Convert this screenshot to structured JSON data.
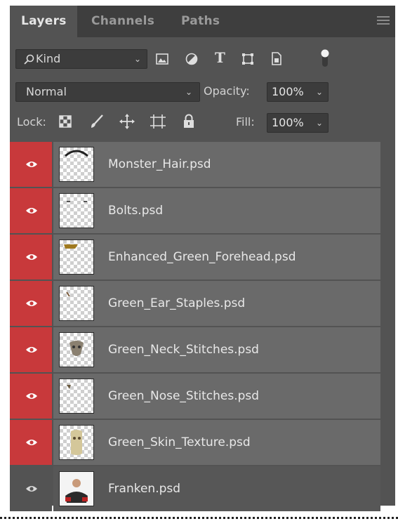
{
  "tabs": [
    {
      "label": "Layers",
      "active": true
    },
    {
      "label": "Channels",
      "active": false
    },
    {
      "label": "Paths",
      "active": false
    }
  ],
  "filter": {
    "label": "Kind",
    "icons": [
      "image-filter-icon",
      "adjustment-filter-icon",
      "type-filter-icon",
      "shape-filter-icon",
      "smart-object-filter-icon",
      "filter-toggle-icon"
    ]
  },
  "blend": {
    "mode": "Normal",
    "opacity_label": "Opacity:",
    "opacity_value": "100%"
  },
  "lock": {
    "label": "Lock:",
    "fill_label": "Fill:",
    "fill_value": "100%",
    "icons": [
      "lock-transparent-icon",
      "lock-paint-icon",
      "lock-position-icon",
      "lock-artboard-icon",
      "lock-all-icon"
    ]
  },
  "layers": [
    {
      "name": "Monster_Hair.psd",
      "selected": true
    },
    {
      "name": "Bolts.psd",
      "selected": true
    },
    {
      "name": "Enhanced_Green_Forehead.psd",
      "selected": true
    },
    {
      "name": "Green_Ear_Staples.psd",
      "selected": true
    },
    {
      "name": "Green_Neck_Stitches.psd",
      "selected": true
    },
    {
      "name": "Green_Nose_Stitches.psd",
      "selected": true
    },
    {
      "name": "Green_Skin_Texture.psd",
      "selected": true
    },
    {
      "name": "Franken.psd",
      "selected": false
    }
  ],
  "colors": {
    "panel": "#535353",
    "tabbar": "#3e3e3e",
    "selected_layer": "#6a6a6a",
    "visibility_highlight": "#c8393b"
  }
}
